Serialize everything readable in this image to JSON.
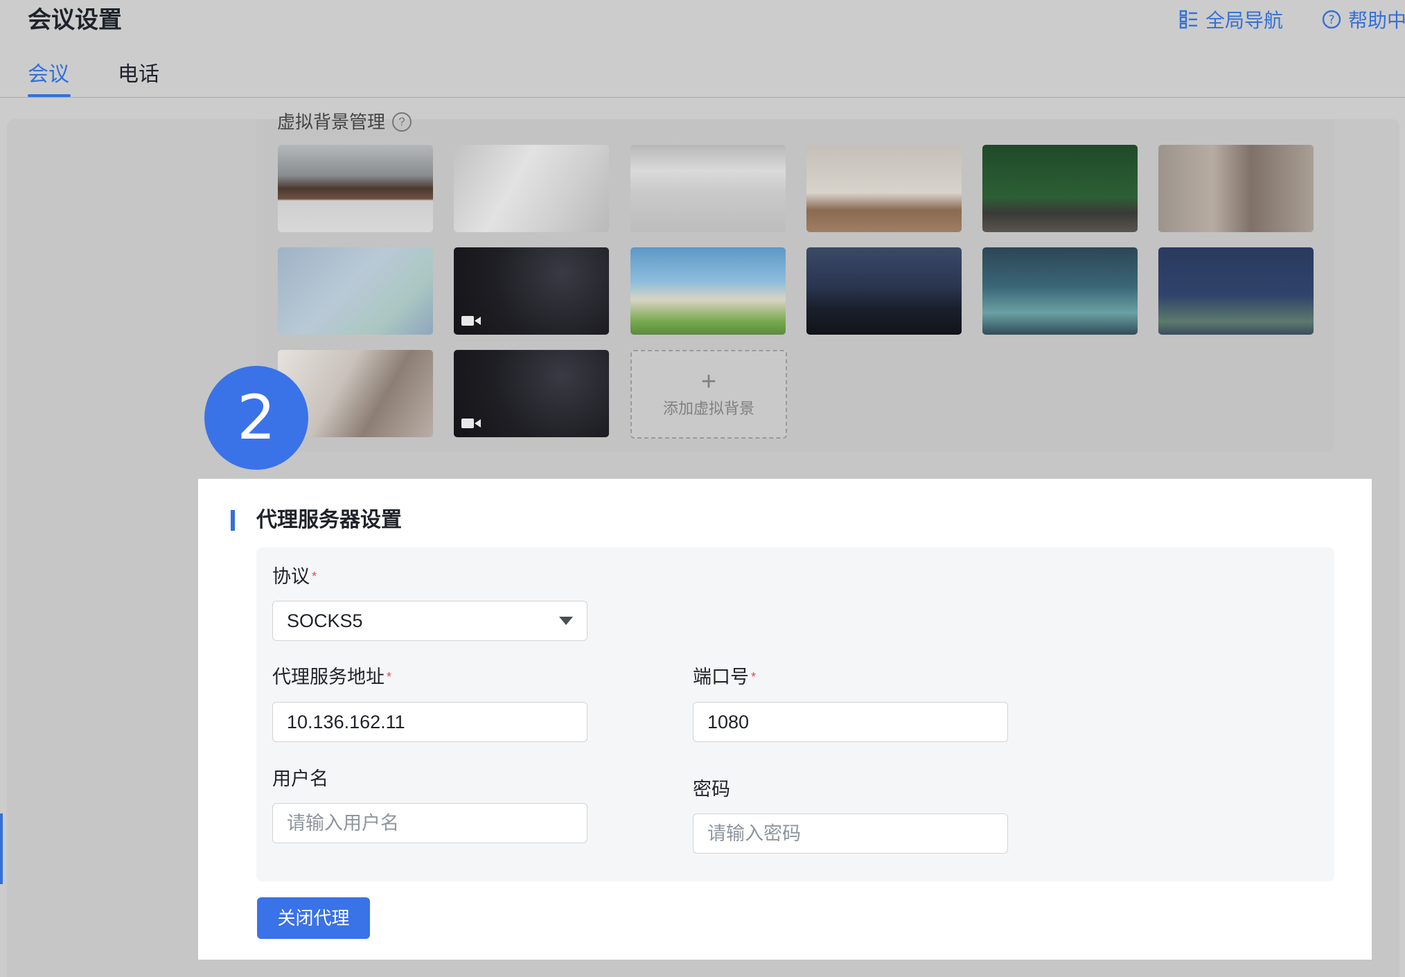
{
  "header": {
    "title": "会议设置",
    "global_nav": "全局导航",
    "help_center": "帮助中心"
  },
  "tabs": [
    {
      "label": "会议",
      "active": true
    },
    {
      "label": "电话",
      "active": false
    }
  ],
  "virtual_background": {
    "title": "虚拟背景管理",
    "add_label": "添加虚拟背景",
    "thumbnails": [
      {
        "name": "office-interior",
        "video": false
      },
      {
        "name": "white-shelf-room",
        "video": false
      },
      {
        "name": "blurred-gray-room",
        "video": false
      },
      {
        "name": "empty-window-room",
        "video": false
      },
      {
        "name": "green-wall-room",
        "video": false
      },
      {
        "name": "beige-living-room",
        "video": false
      },
      {
        "name": "pastel-geometric",
        "video": false
      },
      {
        "name": "starry-night",
        "video": true
      },
      {
        "name": "anime-painter-umbrella",
        "video": false
      },
      {
        "name": "city-night-figure",
        "video": false
      },
      {
        "name": "bokeh-coffee-bean",
        "video": false
      },
      {
        "name": "anime-girl-portrait",
        "video": false
      },
      {
        "name": "guitar-player",
        "video": false
      },
      {
        "name": "starry-night-2",
        "video": true
      }
    ]
  },
  "step_number": "2",
  "proxy": {
    "section_title": "代理服务器设置",
    "protocol_label": "协议",
    "protocol_value": "SOCKS5",
    "address_label": "代理服务地址",
    "address_value": "10.136.162.11",
    "port_label": "端口号",
    "port_value": "1080",
    "username_label": "用户名",
    "username_placeholder": "请输入用户名",
    "password_label": "密码",
    "password_placeholder": "请输入密码",
    "close_button": "关闭代理",
    "required_mark": "*"
  },
  "colors": {
    "accent": "#3370d8",
    "button": "#3a72e8",
    "required": "#e5484d"
  }
}
